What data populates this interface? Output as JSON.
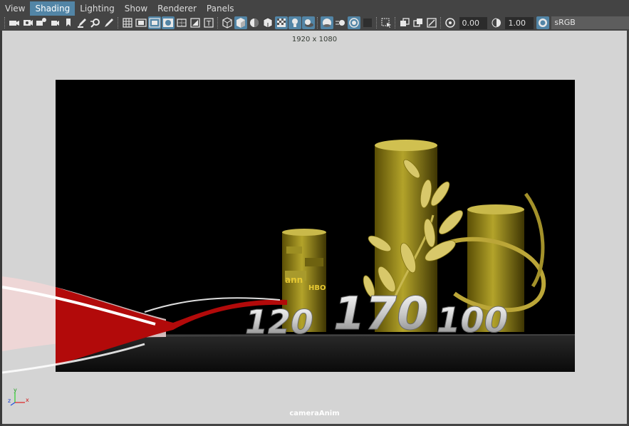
{
  "menubar": {
    "items": [
      {
        "label": "View",
        "active": false
      },
      {
        "label": "Shading",
        "active": true
      },
      {
        "label": "Lighting",
        "active": false
      },
      {
        "label": "Show",
        "active": false
      },
      {
        "label": "Renderer",
        "active": false
      },
      {
        "label": "Panels",
        "active": false
      }
    ]
  },
  "toolbar": {
    "exposure_value": "0.00",
    "gamma_value": "1.00",
    "color_space": "sRGB gamma"
  },
  "viewport": {
    "resolution_label": "1920 x 1080",
    "camera_label": "cameraAnim",
    "axis": {
      "x": "x",
      "y": "y",
      "z": "z"
    }
  },
  "scene": {
    "numbers": [
      "120",
      "170",
      "100"
    ],
    "logo_texts": [
      "ann",
      "HBO"
    ]
  },
  "colors": {
    "accent": "#5285a6",
    "background": "#444444",
    "viewport_bg": "#d4d4d4",
    "gold": "#8a7a10",
    "ribbon_red": "#b20a0a"
  }
}
